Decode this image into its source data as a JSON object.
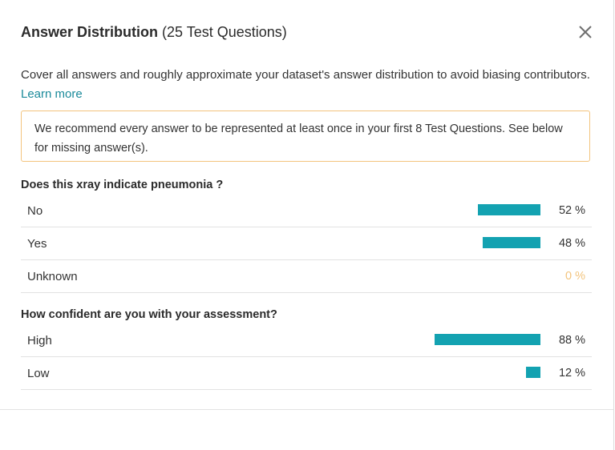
{
  "header": {
    "title_bold": "Answer Distribution",
    "title_rest": "(25 Test Questions)",
    "close_icon": "close-icon"
  },
  "description": {
    "text": "Cover all answers and roughly approximate your dataset's answer distribution to avoid biasing contributors.",
    "learn_more": "Learn more"
  },
  "notice": {
    "text": "We recommend every answer to be represented at least once in your first 8 Test Questions. See below for missing answer(s)."
  },
  "questions": [
    {
      "title": "Does this xray indicate pneumonia ?",
      "answers": [
        {
          "label": "No",
          "percent": 52,
          "percent_text": "52 %"
        },
        {
          "label": "Yes",
          "percent": 48,
          "percent_text": "48 %"
        },
        {
          "label": "Unknown",
          "percent": 0,
          "percent_text": "0 %"
        }
      ]
    },
    {
      "title": "How confident are you with your assessment?",
      "answers": [
        {
          "label": "High",
          "percent": 88,
          "percent_text": "88 %"
        },
        {
          "label": "Low",
          "percent": 12,
          "percent_text": "12 %"
        }
      ]
    }
  ],
  "colors": {
    "bar": "#13a2b1",
    "warning": "#f3c47d",
    "link": "#1a8a9a"
  }
}
